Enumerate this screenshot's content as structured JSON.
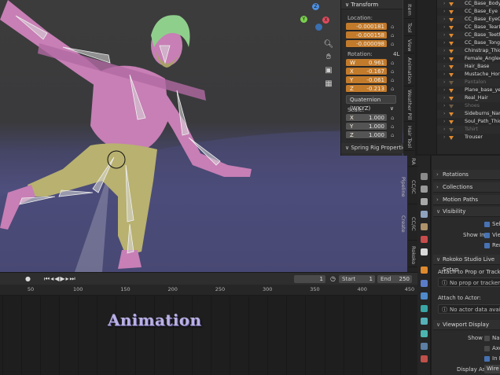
{
  "npanel": {
    "header": "Transform",
    "location_label": "Location:",
    "location": [
      "-0.000181",
      "-0.000158",
      "-0.000098"
    ],
    "rotation_label": "Rotation:",
    "rotation_mode_short": "4L",
    "rotation": [
      {
        "axis": "W",
        "value": "0.961"
      },
      {
        "axis": "X",
        "value": "-0.167"
      },
      {
        "axis": "Y",
        "value": "-0.061"
      },
      {
        "axis": "Z",
        "value": "-0.213"
      }
    ],
    "rotation_mode": "Quaternion (WXYZ)",
    "scale_label": "Scale:",
    "scale": [
      {
        "axis": "X",
        "value": "1.000"
      },
      {
        "axis": "Y",
        "value": "1.000"
      },
      {
        "axis": "Z",
        "value": "1.000"
      }
    ],
    "spring_rig": "Spring Rig Properties"
  },
  "tabs_top": [
    "Item",
    "Tool",
    "View",
    "Animation",
    "Weather Pill",
    "Hair Tool"
  ],
  "tabs_mid": [
    "RA",
    "CC/iC Pipeline",
    "CC/iC Create",
    "Rokoko"
  ],
  "outliner": {
    "items": [
      {
        "label": "CC_Base_Body",
        "dim": false
      },
      {
        "label": "CC_Base_Eye",
        "dim": false
      },
      {
        "label": "CC_Base_EyeOcclusion",
        "dim": false
      },
      {
        "label": "CC_Base_TearLine",
        "dim": false
      },
      {
        "label": "CC_Base_Teeth",
        "dim": false
      },
      {
        "label": "CC_Base_Tongue",
        "dim": false
      },
      {
        "label": "Chinstrap_Thick",
        "dim": false
      },
      {
        "label": "Female_Angled",
        "dim": false
      },
      {
        "label": "Hair_Base",
        "dim": false
      },
      {
        "label": "Mustache_Horseshoe",
        "dim": false
      },
      {
        "label": "Pantalon",
        "dim": true
      },
      {
        "label": "Plane_base_yellow",
        "dim": false
      },
      {
        "label": "Real_Hair",
        "dim": false
      },
      {
        "label": "Shoes",
        "dim": true
      },
      {
        "label": "Sideburns_Narrow",
        "dim": false
      },
      {
        "label": "Soul_Path_Thick",
        "dim": false
      },
      {
        "label": "Tshirt",
        "dim": true
      },
      {
        "label": "Trouser",
        "dim": false
      }
    ]
  },
  "properties": {
    "rotations": "Rotations",
    "collections": "Collections",
    "motion_paths": "Motion Paths",
    "visibility": "Visibility",
    "sel": "Sel",
    "show_in": "Show In",
    "viewport": "View",
    "render": "Ren",
    "rokoko_setup": "Rokoko Studio Live Setup",
    "attach_prop": "Attach to Prop or Tracker:",
    "no_prop": "No prop or tracker data available",
    "attach_actor": "Attach to Actor:",
    "no_actor": "No actor data available",
    "viewport_display": "Viewport Display",
    "show": "Show",
    "names": "Nam",
    "axes": "Axe",
    "in_front": "In F",
    "display_as": "Display As",
    "wire": "Wire"
  },
  "timeline": {
    "current_frame": "1",
    "start_label": "Start",
    "start": "1",
    "end_label": "End",
    "end": "250",
    "ruler": [
      "50",
      "100",
      "150",
      "200",
      "250",
      "300",
      "350",
      "400",
      "450"
    ]
  },
  "overlay_title": "Animation",
  "colors": {
    "accent_orange": "#c27a2b",
    "skin": "#c77fb5",
    "pants": "#b8b170",
    "hair": "#8fcf8c",
    "floor": "#4f4f7e",
    "title": "#b9b1e3"
  },
  "icons": {
    "gizmo": "navigation-gizmo",
    "zoom": "magnifier-icon",
    "pan": "hand-icon",
    "camera": "camera-icon",
    "grid": "grid-icon"
  }
}
